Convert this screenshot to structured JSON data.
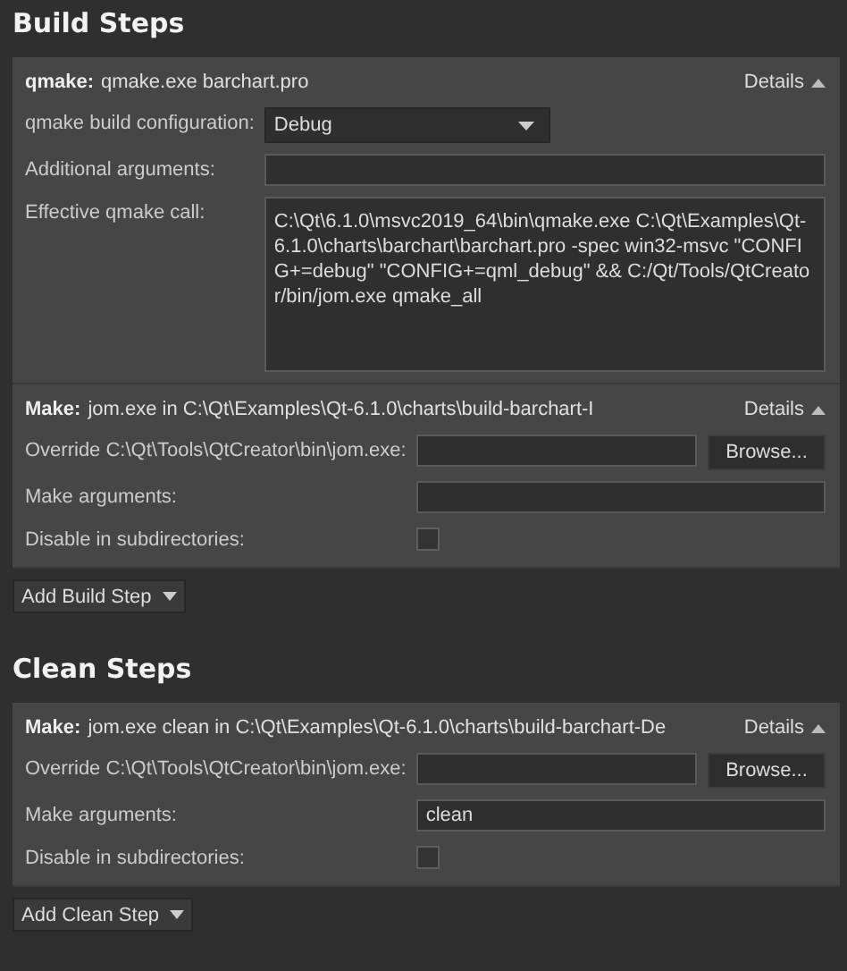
{
  "sections": [
    {
      "title": "Build Steps",
      "add_button": "Add Build Step",
      "steps": [
        {
          "name": "qmake:",
          "summary": "qmake.exe barchart.pro",
          "details": "Details",
          "expanded": true,
          "fields": [
            {
              "kind": "combo",
              "label": "qmake build configuration:",
              "value": "Debug"
            },
            {
              "kind": "text",
              "label": "Additional arguments:"
            },
            {
              "kind": "textarea",
              "label": "Effective qmake call:",
              "value": "C:\\Qt\\6.1.0\\msvc2019_64\\bin\\qmake.exe C:\\Qt\\Examples\\Qt-6.1.0\\charts\\barchart\\barchart.pro -spec win32-msvc \"CONFIG+=debug\" \"CONFIG+=qml_debug\" && C:/Qt/Tools/QtCreator/bin/jom.exe qmake_all"
            }
          ]
        },
        {
          "name": "Make:",
          "summary": "jom.exe in C:\\Qt\\Examples\\Qt-6.1.0\\charts\\build-barchart-I",
          "details": "Details",
          "expanded": true,
          "fields": [
            {
              "kind": "path",
              "label": "Override C:\\Qt\\Tools\\QtCreator\\bin\\jom.exe:",
              "button": "Browse..."
            },
            {
              "kind": "text",
              "label": "Make arguments:"
            },
            {
              "kind": "checkbox",
              "label": "Disable in subdirectories:",
              "checked": false
            }
          ]
        }
      ]
    },
    {
      "title": "Clean Steps",
      "add_button": "Add Clean Step",
      "steps": [
        {
          "name": "Make:",
          "summary": "jom.exe clean in C:\\Qt\\Examples\\Qt-6.1.0\\charts\\build-barchart-De",
          "details": "Details",
          "expanded": true,
          "fields": [
            {
              "kind": "path",
              "label": "Override C:\\Qt\\Tools\\QtCreator\\bin\\jom.exe:",
              "button": "Browse..."
            },
            {
              "kind": "text",
              "label": "Make arguments:",
              "value": "clean"
            },
            {
              "kind": "checkbox",
              "label": "Disable in subdirectories:",
              "checked": false
            }
          ]
        }
      ]
    }
  ]
}
